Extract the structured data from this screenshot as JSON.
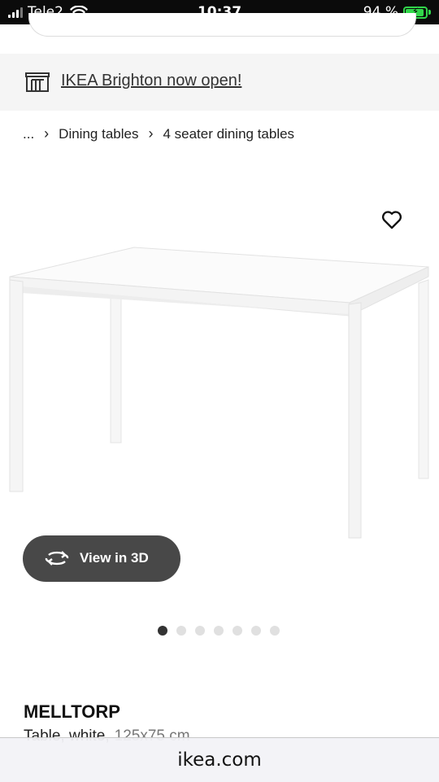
{
  "status_bar": {
    "carrier": "Tele2",
    "time": "10:37",
    "battery_percent_label": "94 %",
    "battery_level": 0.94,
    "charging": true,
    "signal_bars": 3
  },
  "banner": {
    "icon": "store-icon",
    "text": "IKEA Brighton now open!"
  },
  "breadcrumb": {
    "ellipsis": "...",
    "items": [
      "Dining tables",
      "4 seater dining tables"
    ]
  },
  "gallery": {
    "favorite_icon": "heart-icon",
    "view_3d_label": "View in 3D",
    "view_3d_icon": "rotate-3d-icon",
    "total_images": 7,
    "active_index": 0
  },
  "product": {
    "name": "MELLTORP",
    "description": "Table, white,",
    "size": "125x75 cm"
  },
  "browser": {
    "url": "ikea.com"
  },
  "colors": {
    "button_bg": "#484848",
    "banner_bg": "#f5f5f5",
    "battery": "#32d74b"
  }
}
